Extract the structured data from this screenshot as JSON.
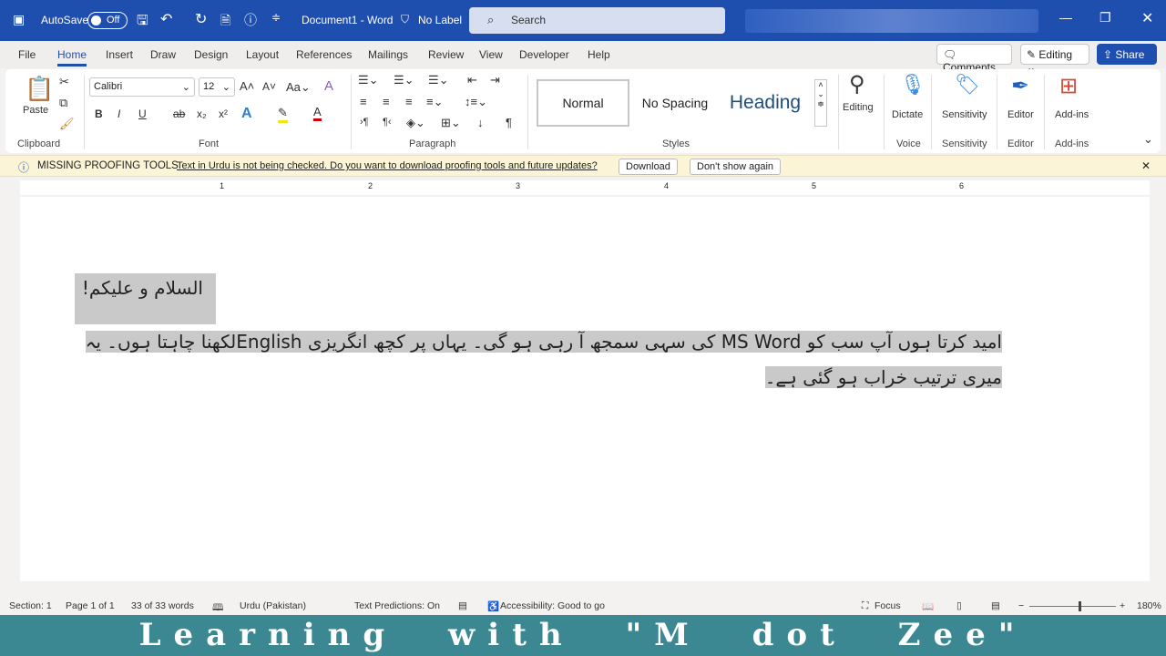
{
  "titlebar": {
    "autosave": "AutoSave",
    "toggle": "Off",
    "doc_title": "Document1 - Word",
    "label": "No Label",
    "search_placeholder": "Search"
  },
  "tabs": [
    "File",
    "Home",
    "Insert",
    "Draw",
    "Design",
    "Layout",
    "References",
    "Mailings",
    "Review",
    "View",
    "Developer",
    "Help"
  ],
  "header_buttons": {
    "comments": "Comments",
    "editing": "Editing",
    "share": "Share"
  },
  "ribbon": {
    "clipboard": {
      "paste": "Paste",
      "label": "Clipboard"
    },
    "font": {
      "name": "Calibri",
      "size": "12",
      "label": "Font",
      "bold": "B",
      "italic": "I",
      "underline": "U",
      "strike": "ab",
      "sub": "x₂",
      "sup": "x²"
    },
    "paragraph": {
      "label": "Paragraph"
    },
    "styles": {
      "items": [
        "Normal",
        "No Spacing",
        "Heading"
      ],
      "label": "Styles"
    },
    "editing": "Editing",
    "dictate": "Dictate",
    "sensitivity": "Sensitivity",
    "editor": "Editor",
    "addins": "Add-ins",
    "groups": {
      "voice": "Voice",
      "sensitivity": "Sensitivity",
      "editor": "Editor",
      "addins": "Add-ins"
    }
  },
  "message_bar": {
    "title": "MISSING PROOFING TOOLS",
    "text": "Text in Urdu is not being checked. Do you want to download proofing tools and future updates?",
    "download": "Download",
    "dont_show": "Don't show again"
  },
  "ruler": [
    "1",
    "2",
    "3",
    "4",
    "5",
    "6"
  ],
  "document": {
    "line1": "السلام و علیکم!",
    "para2": "امید کرتا ہوں آپ سب کو MS Word کی سہی سمجھ آ رہی ہو گی۔ یہاں پر کچھ انگریزی  Englishلکھنا چاہتا ہوں۔ یہ میری ترتیب خراب ہو گئی ہے۔"
  },
  "status": {
    "section": "Section: 1",
    "page": "Page 1 of 1",
    "words": "33 of 33 words",
    "language": "Urdu (Pakistan)",
    "predictions": "Text Predictions: On",
    "accessibility": "Accessibility: Good to go",
    "focus": "Focus",
    "zoom": "180%"
  },
  "banner": "Learning with \"M dot Zee\""
}
